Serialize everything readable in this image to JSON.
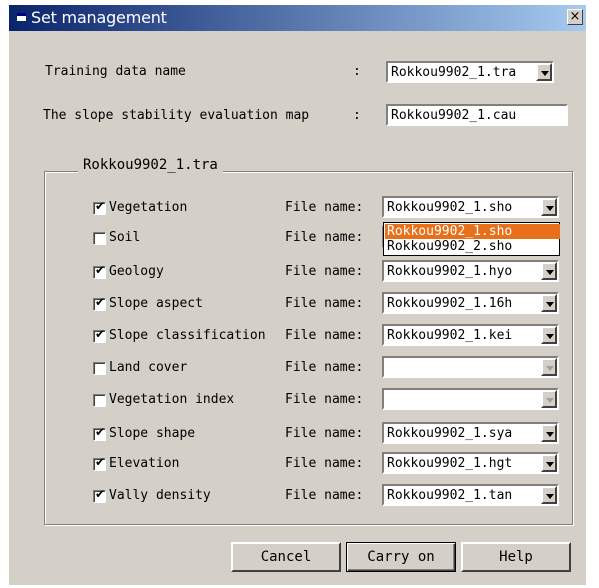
{
  "window": {
    "title": "Set management",
    "close_symbol": "×"
  },
  "training": {
    "label": "Training data name",
    "colon": ":",
    "value": "Rokkou9902_1.tra"
  },
  "stability": {
    "label": "The slope stability evaluation map",
    "colon": ":",
    "value": "Rokkou9902_1.cau"
  },
  "group": {
    "title": "Rokkou9902_1.tra",
    "file_label": "File name:",
    "rows": [
      {
        "label": "Vegetation",
        "checked": true,
        "value": "Rokkou9902_1.sho",
        "enabled": true
      },
      {
        "label": "Soil",
        "checked": false,
        "value": "",
        "enabled": true
      },
      {
        "label": "Geology",
        "checked": true,
        "value": "Rokkou9902_1.hyo",
        "enabled": true
      },
      {
        "label": "Slope aspect",
        "checked": true,
        "value": "Rokkou9902_1.16h",
        "enabled": true
      },
      {
        "label": "Slope classification",
        "checked": true,
        "value": "Rokkou9902_1.kei",
        "enabled": true
      },
      {
        "label": "Land cover",
        "checked": false,
        "value": "",
        "enabled": false
      },
      {
        "label": "Vegetation index",
        "checked": false,
        "value": "",
        "enabled": false
      },
      {
        "label": "Slope shape",
        "checked": true,
        "value": "Rokkou9902_1.sya",
        "enabled": true
      },
      {
        "label": "Elevation",
        "checked": true,
        "value": "Rokkou9902_1.hgt",
        "enabled": true
      },
      {
        "label": "Vally density",
        "checked": true,
        "value": "Rokkou9902_1.tan",
        "enabled": true
      }
    ]
  },
  "dropdown_open": {
    "options": [
      "Rokkou9902_1.sho",
      "Rokkou9902_2.sho"
    ],
    "selected_index": 0
  },
  "buttons": {
    "cancel": "Cancel",
    "carry_on": "Carry on",
    "help": "Help"
  },
  "check_mark": "✔",
  "colors": {
    "title_start": "#0a246a",
    "title_end": "#a6caf0",
    "face": "#d4d0c8",
    "highlight": "#e8701a"
  }
}
